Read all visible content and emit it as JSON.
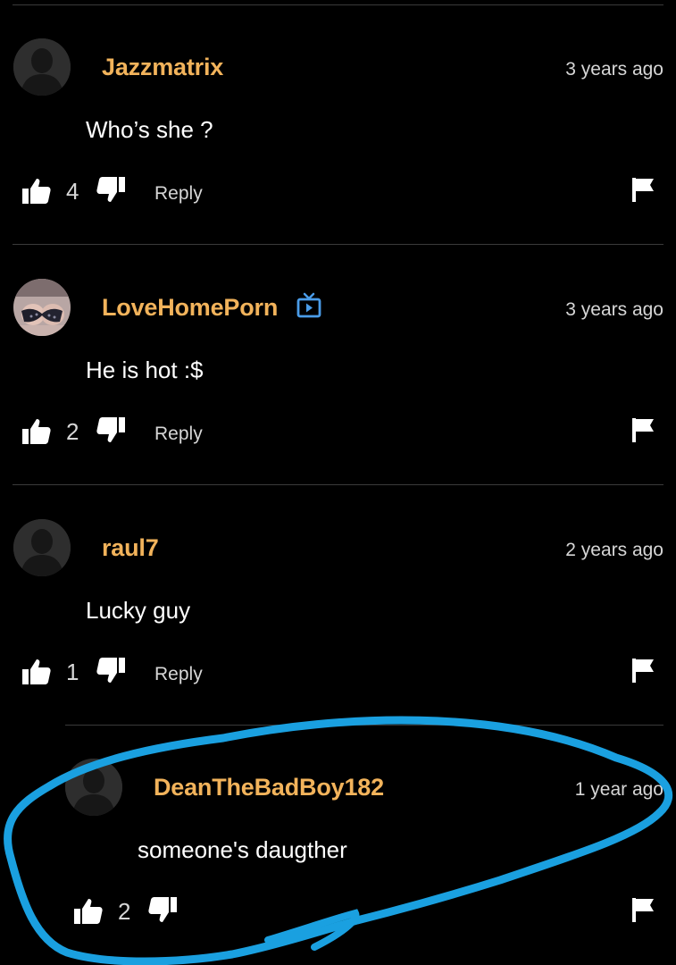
{
  "colors": {
    "background": "#000000",
    "username": "#f2b35b",
    "text": "#ffffff",
    "muted": "#d6d6d6",
    "divider": "#3a3a3a",
    "badge": "#4a9ce8",
    "highlight_annotation": "#1aa0e0"
  },
  "comments": [
    {
      "username": "Jazzmatrix",
      "timestamp": "3 years ago",
      "text": "Who’s she ?",
      "likes": "4",
      "reply_label": "Reply",
      "avatar": "default-avatar",
      "badge": null
    },
    {
      "username": "LoveHomePorn",
      "timestamp": "3 years ago",
      "text": "He is hot :$",
      "likes": "2",
      "reply_label": "Reply",
      "avatar": "user-photo-avatar",
      "badge": "channel-tv-icon"
    },
    {
      "username": "raul7",
      "timestamp": "2 years ago",
      "text": "Lucky guy",
      "likes": "1",
      "reply_label": "Reply",
      "avatar": "default-avatar",
      "badge": null
    },
    {
      "username": "DeanTheBadBoy182",
      "timestamp": "1 year ago",
      "text": "someone's daugther",
      "likes": "2",
      "reply_label": null,
      "avatar": "default-avatar",
      "badge": null,
      "is_reply": true
    }
  ],
  "icons": {
    "like": "thumbs-up-icon",
    "dislike": "thumbs-down-icon",
    "report": "flag-icon"
  }
}
